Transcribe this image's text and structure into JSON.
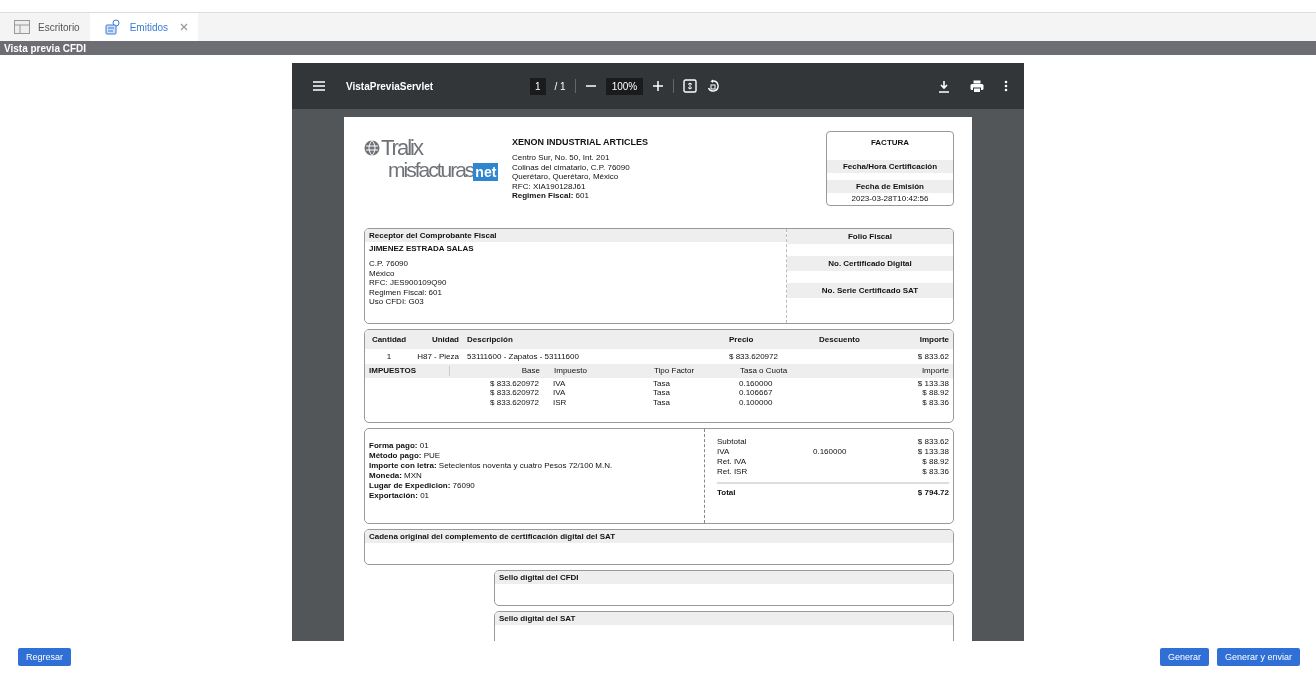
{
  "tabs": [
    {
      "label": "Escritorio",
      "selected": false,
      "closable": false
    },
    {
      "label": "Emitidos",
      "selected": true,
      "closable": true
    }
  ],
  "panel": {
    "title": "Vista previa CFDI"
  },
  "viewer": {
    "title": "VistaPreviaServlet",
    "page": "1",
    "page_total": "/ 1",
    "zoom": "100%"
  },
  "document": {
    "logo": {
      "top": "Tralix",
      "bottom": "misfacturas",
      "badge": "net"
    },
    "issuer": {
      "name": "XENON INDUSTRIAL ARTICLES",
      "lines": [
        "Centro Sur, No. 50, Int. 201",
        "Colinas del cimatario, C.P. 76090",
        "Querétaro, Querétaro, México",
        "RFC: XIA190128J61"
      ],
      "regime_label": "Regimen Fiscal:",
      "regime": "601"
    },
    "doc_box": {
      "title": "FACTURA",
      "certification_label": "Fecha/Hora Certificación",
      "emission_label": "Fecha de Emisión",
      "emission_date": "2023-03-28T10:42:56"
    },
    "receptor": {
      "title": "Receptor del Comprobante Fiscal",
      "name": "JIMENEZ ESTRADA SALAS",
      "lines": [
        "C.P. 76090",
        "México",
        "RFC: JES900109Q90",
        "Regimen Fiscal: 601",
        "Uso CFDI: G03"
      ],
      "labels": [
        "Folio Fiscal",
        "No. Certificado Digital",
        "No. Serie Certificado SAT"
      ]
    },
    "items": {
      "columns": [
        "Cantidad",
        "Unidad",
        "Descripción",
        "Precio",
        "Descuento",
        "Importe"
      ],
      "rows": [
        {
          "quantity": "1",
          "unit": "H87 - Pieza",
          "description": "53111600 - Zapatos - 53111600",
          "price": "$ 833.620972",
          "amount": "$ 833.62"
        }
      ]
    },
    "taxes": {
      "title": "IMPUESTOS",
      "columns": [
        "Base",
        "Impuesto",
        "Tipo Factor",
        "Tasa o Cuota",
        "Importe"
      ],
      "rows": [
        [
          "$ 833.620972",
          "IVA",
          "Tasa",
          "0.160000",
          "$ 133.38"
        ],
        [
          "$ 833.620972",
          "IVA",
          "Tasa",
          "0.106667",
          "$ 88.92"
        ],
        [
          "$ 833.620972",
          "ISR",
          "Tasa",
          "0.100000",
          "$ 83.36"
        ]
      ]
    },
    "payment": [
      {
        "label": "Forma pago:",
        "value": "01"
      },
      {
        "label": "Método pago:",
        "value": "PUE"
      },
      {
        "label": "Importe con letra:",
        "value": "Setecientos noventa y cuatro Pesos 72/100 M.N."
      },
      {
        "label": "Moneda:",
        "value": "MXN"
      },
      {
        "label": "Lugar de Expedicion:",
        "value": "76090"
      },
      {
        "label": "Exportación:",
        "value": "01"
      }
    ],
    "totals": [
      {
        "label": "Subtotal",
        "value": "$ 833.62"
      },
      {
        "label": "IVA",
        "rate": "0.160000",
        "value": "$ 133.38"
      },
      {
        "label": "Ret. IVA",
        "value": "$ 88.92"
      },
      {
        "label": "Ret. ISR",
        "value": "$ 83.36"
      }
    ],
    "total": {
      "label": "Total",
      "value": "$ 794.72"
    },
    "sections": [
      {
        "title": "Cadena original del complemento de certificación digital del SAT",
        "kind": "wide"
      },
      {
        "title": "Sello digital del CFDI",
        "kind": "narrow"
      },
      {
        "title": "Sello digital del SAT",
        "kind": "narrow"
      }
    ]
  },
  "buttons": {
    "left": [
      "Regresar"
    ],
    "right": [
      "Generar",
      "Generar y enviar"
    ]
  }
}
